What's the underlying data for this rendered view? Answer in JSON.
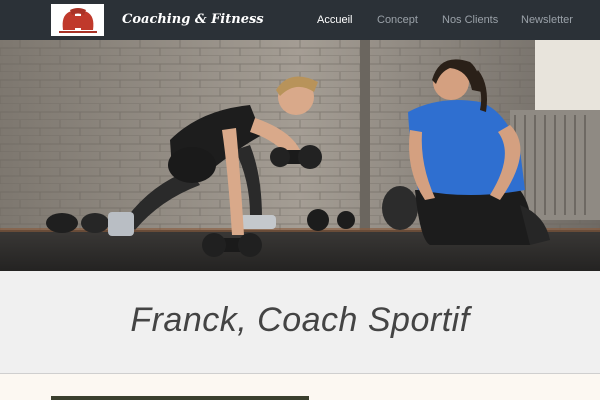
{
  "brand": {
    "name": "Coaching & Fitness",
    "logo_icon": "spartan-helmet-icon",
    "logo_color": "#c0392b"
  },
  "nav": {
    "items": [
      {
        "label": "Accueil",
        "active": true
      },
      {
        "label": "Concept",
        "active": false
      },
      {
        "label": "Nos Clients",
        "active": false
      },
      {
        "label": "Newsletter",
        "active": false
      }
    ]
  },
  "hero": {
    "description": "gym-training-photo"
  },
  "page": {
    "title": "Franck, Coach Sportif"
  },
  "colors": {
    "navbar": "#2b3137",
    "nav_active": "#ffffff",
    "nav_inactive": "#9aa1a8",
    "title_band": "#f0f0f0",
    "page_bg": "#fcf8f2"
  }
}
